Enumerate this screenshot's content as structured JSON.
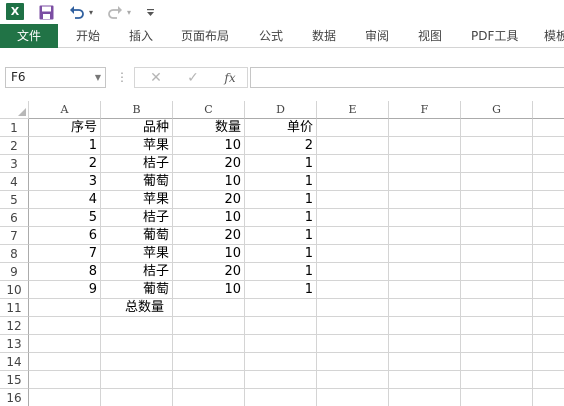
{
  "app": {
    "logo_text": "X"
  },
  "quick_access": {
    "save_icon": "save-icon",
    "undo_icon": "undo-icon",
    "redo_icon": "redo-icon",
    "customize_icon": "customize-icon"
  },
  "ribbon": {
    "tabs": [
      "文件",
      "开始",
      "插入",
      "页面布局",
      "公式",
      "数据",
      "审阅",
      "视图",
      "PDF工具",
      "模板"
    ]
  },
  "formula_bar": {
    "name_box": "F6",
    "cancel_glyph": "✕",
    "enter_glyph": "✓",
    "fx_label": "fx",
    "formula_value": ""
  },
  "sheet": {
    "columns": [
      "A",
      "B",
      "C",
      "D",
      "E",
      "F",
      "G"
    ],
    "rows": [
      "1",
      "2",
      "3",
      "4",
      "5",
      "6",
      "7",
      "8",
      "9",
      "10",
      "11",
      "12",
      "13",
      "14",
      "15",
      "16"
    ],
    "cells": [
      [
        "序号",
        "品种",
        "数量",
        "单价"
      ],
      [
        "1",
        "苹果",
        "10",
        "2"
      ],
      [
        "2",
        "桔子",
        "20",
        "1"
      ],
      [
        "3",
        "葡萄",
        "10",
        "1"
      ],
      [
        "4",
        "苹果",
        "20",
        "1"
      ],
      [
        "5",
        "桔子",
        "10",
        "1"
      ],
      [
        "6",
        "葡萄",
        "20",
        "1"
      ],
      [
        "7",
        "苹果",
        "10",
        "1"
      ],
      [
        "8",
        "桔子",
        "20",
        "1"
      ],
      [
        "9",
        "葡萄",
        "10",
        "1"
      ],
      [
        "",
        "总数量",
        "",
        ""
      ]
    ],
    "selected_cell": "F6"
  }
}
